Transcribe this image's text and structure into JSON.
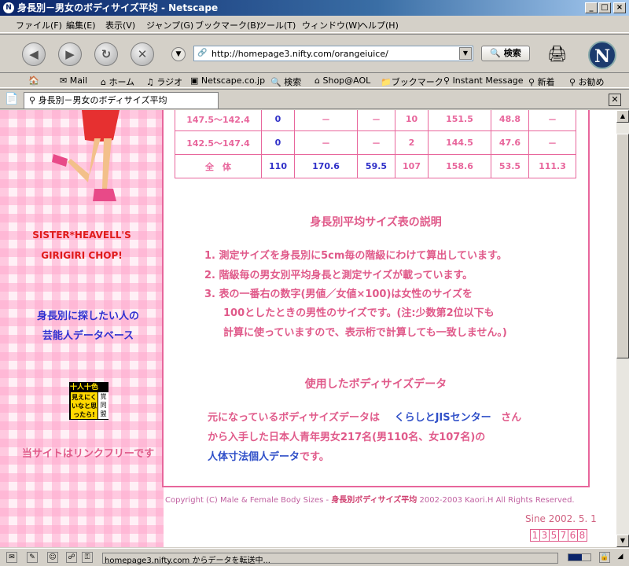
{
  "window": {
    "title": "身長別－男女のボディサイズ平均 - Netscape"
  },
  "menu": [
    "ファイル(F)",
    "編集(E)",
    "表示(V)",
    "ジャンプ(G)",
    "ブックマーク(B)",
    "ツール(T)",
    "ウィンドウ(W)",
    "ヘルプ(H)"
  ],
  "nav": {
    "url": "http://homepage3.nifty.com/orangeiuice/",
    "search_label": "検索",
    "logo": "N"
  },
  "bookmarks": [
    "Mail",
    "ホーム",
    "ラジオ",
    "Netscape.co.jp",
    "検索",
    "Shop@AOL",
    "ブックマーク",
    "Instant Message",
    "新着",
    "お勧め"
  ],
  "tab": {
    "label": "身長別－男女のボディサイズ平均"
  },
  "sidebar": {
    "title_line1": "SISTER*HEAVELL'S",
    "title_line2": "GIRIGIRI CHOP!",
    "link_line1": "身長別に探したい人の",
    "link_line2": "芸能人データベース",
    "badge_top": "十人十色",
    "badge_text": "見えにく いなと思 ったら!",
    "badge_side": "覚 同 盟",
    "linkfree": "当サイトはリンクフリーです"
  },
  "table": {
    "rows": [
      [
        "147.5～142.4",
        "0",
        "－",
        "－",
        "10",
        "151.5",
        "48.8",
        "－"
      ],
      [
        "142.5～147.4",
        "0",
        "－",
        "－",
        "2",
        "144.5",
        "47.6",
        "－"
      ],
      [
        "全　体",
        "110",
        "170.6",
        "59.5",
        "107",
        "158.6",
        "53.5",
        "111.3"
      ]
    ]
  },
  "explanation": {
    "heading": "身長別平均サイズ表の説明",
    "item1": "1. 測定サイズを身長別に5cm毎の階級にわけて算出しています。",
    "item2": "2. 階級毎の男女別平均身長と測定サイズが載っています。",
    "item3a": "3. 表の一番右の数字(男値／女値×100)は女性のサイズを",
    "item3b": "100としたときの男性のサイズです。(注:少数第2位以下も",
    "item3c": "計算に使っていますので、表示桁で計算しても一致しません。)"
  },
  "data_source": {
    "heading": "使用したボディサイズデータ",
    "line1_pre": "元になっているボディサイズデータは",
    "line1_link": "くらしとJISセンター",
    "line1_post": "さん",
    "line2": "から入手した日本人青年男女217名(男110名、女107名)の",
    "line3_link": "人体寸法個人データ",
    "line3_post": "です。"
  },
  "footer": {
    "copyright_pre": "Copyright (C) Male & Female Body Sizes - ",
    "copyright_strong": "身長別ボディサイズ平均",
    "copyright_post": " 2002-2003 Kaori.H All Rights Reserved.",
    "since": "Sine 2002. 5. 1",
    "counter": [
      "1",
      "3",
      "5",
      "7",
      "6",
      "8"
    ]
  },
  "status": {
    "text": "homepage3.nifty.com からデータを転送中..."
  }
}
